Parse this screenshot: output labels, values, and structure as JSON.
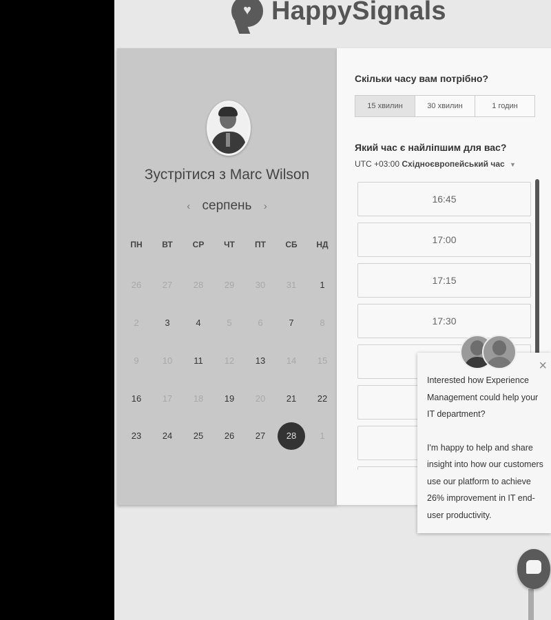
{
  "brand": {
    "name": "HappySignals"
  },
  "calendar": {
    "title_prefix": "Зустрітися з ",
    "host_name": "Marc Wilson",
    "month": "серпень",
    "prev_arrow": "‹",
    "next_arrow": "›",
    "weekdays": [
      "ПН",
      "ВТ",
      "СР",
      "ЧТ",
      "ПТ",
      "СБ",
      "НД"
    ],
    "weeks": [
      [
        {
          "d": "26",
          "m": 1
        },
        {
          "d": "27",
          "m": 1
        },
        {
          "d": "28",
          "m": 1
        },
        {
          "d": "29",
          "m": 1
        },
        {
          "d": "30",
          "m": 1
        },
        {
          "d": "31",
          "m": 1
        },
        {
          "d": "1",
          "m": 0
        }
      ],
      [
        {
          "d": "2",
          "m": 1
        },
        {
          "d": "3",
          "m": 0
        },
        {
          "d": "4",
          "m": 0
        },
        {
          "d": "5",
          "m": 1
        },
        {
          "d": "6",
          "m": 1
        },
        {
          "d": "7",
          "m": 0
        },
        {
          "d": "8",
          "m": 1
        }
      ],
      [
        {
          "d": "9",
          "m": 1
        },
        {
          "d": "10",
          "m": 1
        },
        {
          "d": "11",
          "m": 0
        },
        {
          "d": "12",
          "m": 1
        },
        {
          "d": "13",
          "m": 0
        },
        {
          "d": "14",
          "m": 1
        },
        {
          "d": "15",
          "m": 1
        }
      ],
      [
        {
          "d": "16",
          "m": 0
        },
        {
          "d": "17",
          "m": 1
        },
        {
          "d": "18",
          "m": 1
        },
        {
          "d": "19",
          "m": 0
        },
        {
          "d": "20",
          "m": 1
        },
        {
          "d": "21",
          "m": 0
        },
        {
          "d": "22",
          "m": 0
        }
      ],
      [
        {
          "d": "23",
          "m": 0
        },
        {
          "d": "24",
          "m": 0
        },
        {
          "d": "25",
          "m": 0
        },
        {
          "d": "26",
          "m": 0
        },
        {
          "d": "27",
          "m": 0
        },
        {
          "d": "28",
          "m": 0,
          "sel": 1
        },
        {
          "d": "1",
          "m": 1
        }
      ]
    ]
  },
  "scheduler": {
    "duration_question": "Скільки часу вам потрібно?",
    "durations": [
      "15 хвилин",
      "30 хвилин",
      "1 годин"
    ],
    "active_duration": 0,
    "time_question": "Який час є найліпшим для вас?",
    "timezone_offset": "UTC +03:00",
    "timezone_name": "Східноєвропейський час",
    "slots": [
      "16:45",
      "17:00",
      "17:15",
      "17:30",
      "",
      "",
      "",
      ""
    ]
  },
  "chat": {
    "message_1": "Interested how Experience Management could help your IT department?",
    "message_2": "I'm happy to help and share insight into how our customers use our platform to achieve 26% improvement in IT end-user productivity.",
    "close_symbol": "×"
  }
}
